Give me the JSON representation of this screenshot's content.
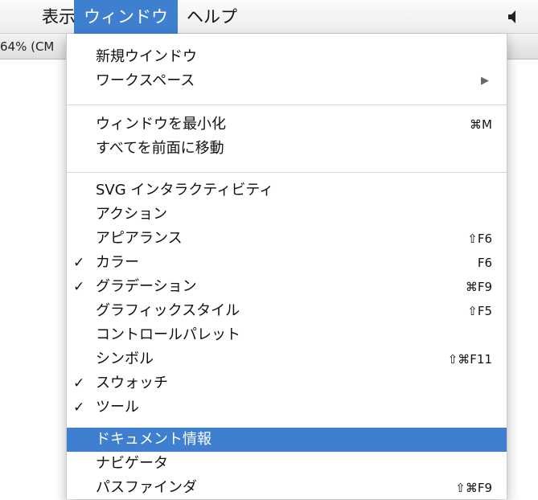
{
  "menubar": {
    "view": "表示",
    "window": "ウィンドウ",
    "help": "ヘルプ"
  },
  "docbar": {
    "zoom_text": "64% (CM"
  },
  "menu": {
    "group1": [
      {
        "label": "新規ウインドウ",
        "shortcut": "",
        "submenu": false,
        "checked": false
      },
      {
        "label": "ワークスペース",
        "shortcut": "",
        "submenu": true,
        "checked": false
      }
    ],
    "group2": [
      {
        "label": "ウィンドウを最小化",
        "shortcut": "⌘M",
        "checked": false
      },
      {
        "label": "すべてを前面に移動",
        "shortcut": "",
        "checked": false
      }
    ],
    "group3": [
      {
        "label": "SVG インタラクティビティ",
        "shortcut": "",
        "checked": false
      },
      {
        "label": "アクション",
        "shortcut": "",
        "checked": false
      },
      {
        "label": "アピアランス",
        "shortcut": "⇧F6",
        "checked": false
      },
      {
        "label": "カラー",
        "shortcut": "F6",
        "checked": true
      },
      {
        "label": "グラデーション",
        "shortcut": "⌘F9",
        "checked": true
      },
      {
        "label": "グラフィックスタイル",
        "shortcut": "⇧F5",
        "checked": false
      },
      {
        "label": "コントロールパレット",
        "shortcut": "",
        "checked": false
      },
      {
        "label": "シンボル",
        "shortcut": "⇧⌘F11",
        "checked": false
      },
      {
        "label": "スウォッチ",
        "shortcut": "",
        "checked": true
      },
      {
        "label": "ツール",
        "shortcut": "",
        "checked": true
      },
      {
        "label": "ドキュメント情報",
        "shortcut": "",
        "checked": false,
        "highlighted": true
      },
      {
        "label": "ナビゲータ",
        "shortcut": "",
        "checked": false
      },
      {
        "label": "パスファインダ",
        "shortcut": "⇧⌘F9",
        "checked": false
      }
    ],
    "check_glyph": "✓",
    "submenu_glyph": "▶"
  },
  "colors": {
    "highlight": "#3e7fcf"
  }
}
